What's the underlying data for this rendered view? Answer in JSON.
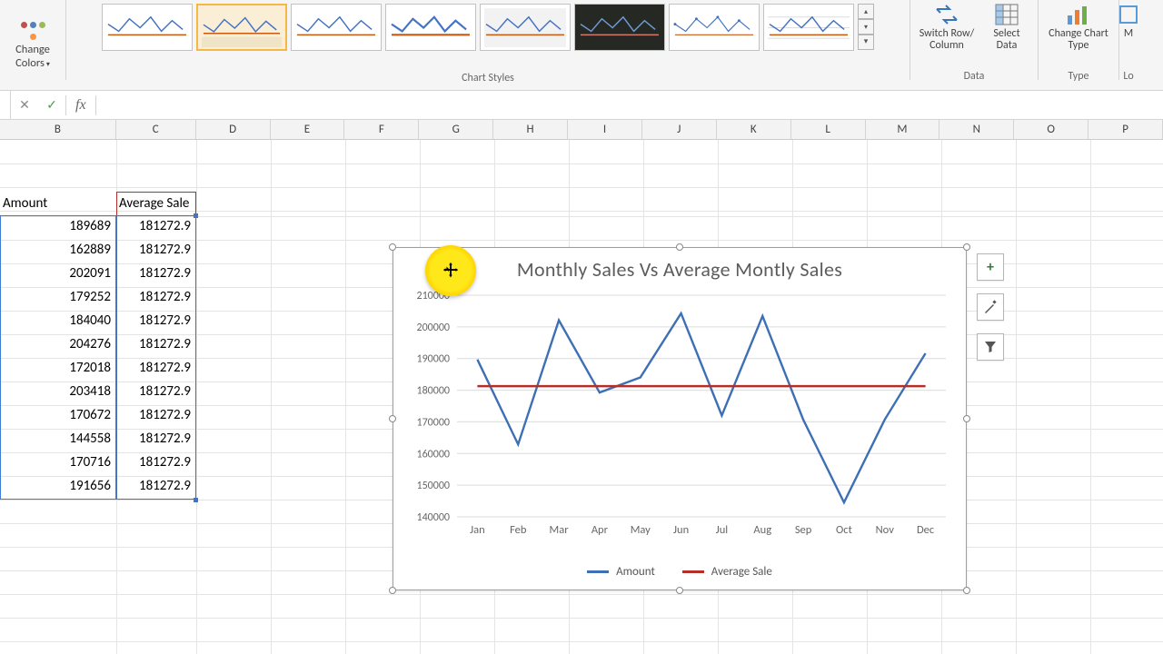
{
  "ribbon": {
    "change_colors": "Change Colors",
    "groups": {
      "styles": "Chart Styles",
      "data": "Data",
      "type": "Type",
      "loc": "Lo"
    },
    "buttons": {
      "switch": "Switch Row/ Column",
      "select_data": "Select Data",
      "change_type": "Change Chart Type"
    },
    "gallery_more": "▾"
  },
  "formula_bar": {
    "cancel": "✕",
    "enter": "✓",
    "fx": "fx",
    "value": ""
  },
  "columns": [
    "B",
    "C",
    "D",
    "E",
    "F",
    "G",
    "H",
    "I",
    "J",
    "K",
    "L",
    "M",
    "N",
    "O",
    "P"
  ],
  "table": {
    "headers": {
      "b": "Amount",
      "c": "Average Sale"
    },
    "rows": [
      {
        "b": 189689,
        "c": "181272.9"
      },
      {
        "b": 162889,
        "c": "181272.9"
      },
      {
        "b": 202091,
        "c": "181272.9"
      },
      {
        "b": 179252,
        "c": "181272.9"
      },
      {
        "b": 184040,
        "c": "181272.9"
      },
      {
        "b": 204276,
        "c": "181272.9"
      },
      {
        "b": 172018,
        "c": "181272.9"
      },
      {
        "b": 203418,
        "c": "181272.9"
      },
      {
        "b": 170672,
        "c": "181272.9"
      },
      {
        "b": 144558,
        "c": "181272.9"
      },
      {
        "b": 170716,
        "c": "181272.9"
      },
      {
        "b": 191656,
        "c": "181272.9"
      }
    ]
  },
  "chart_helpers": {
    "add": "+",
    "brush": "✎",
    "filter": "▼"
  },
  "chart_data": {
    "type": "line",
    "title": "Monthly Sales Vs Average Montly Sales",
    "xlabel": "",
    "ylabel": "",
    "ylim": [
      140000,
      210000
    ],
    "yticks": [
      140000,
      150000,
      160000,
      170000,
      180000,
      190000,
      200000,
      210000
    ],
    "categories": [
      "Jan",
      "Feb",
      "Mar",
      "Apr",
      "May",
      "Jun",
      "Jul",
      "Aug",
      "Sep",
      "Oct",
      "Nov",
      "Dec"
    ],
    "series": [
      {
        "name": "Amount",
        "color": "#3d6fb5",
        "values": [
          189689,
          162889,
          202091,
          179252,
          184040,
          204276,
          172018,
          203418,
          170672,
          144558,
          170716,
          191656
        ]
      },
      {
        "name": "Average Sale",
        "color": "#b52f2a",
        "values": [
          181272.9,
          181272.9,
          181272.9,
          181272.9,
          181272.9,
          181272.9,
          181272.9,
          181272.9,
          181272.9,
          181272.9,
          181272.9,
          181272.9
        ]
      }
    ]
  }
}
